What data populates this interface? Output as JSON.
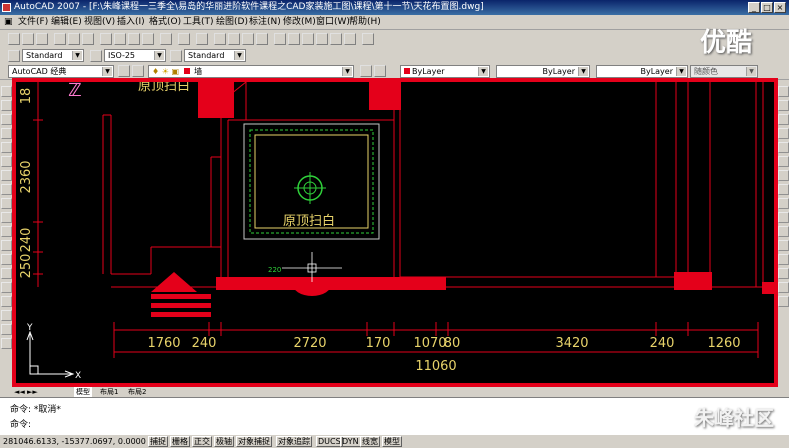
{
  "window": {
    "title": "AutoCAD 2007 - [F:\\朱峰课程一三季全\\易岛的华丽进阶软件课程之CAD家装施工图\\课程\\第十一节\\天花布置图.dwg]"
  },
  "menu": [
    "文件(F)",
    "编辑(E)",
    "视图(V)",
    "插入(I)",
    "格式(O)",
    "工具(T)",
    "绘图(D)",
    "标注(N)",
    "修改(M)",
    "窗口(W)",
    "帮助(H)"
  ],
  "styles": {
    "text_style": "Standard",
    "dim_style": "ISO-25",
    "table_style": "Standard"
  },
  "workspace": "AutoCAD 经典",
  "layer": {
    "current": "墙",
    "color": "ByLayer",
    "linetype": "ByLayer",
    "lineweight": "ByLayer",
    "plotstyle": "随颜色"
  },
  "drawing": {
    "label_top": "原顶扫白",
    "label_center": "原顶扫白",
    "elev_tag": "220",
    "vertical_dims": [
      "18",
      "2360",
      "240",
      "250"
    ],
    "horizontal_dims": [
      "1760",
      "240",
      "2720",
      "170",
      "1070",
      "80",
      "3420",
      "240",
      "1260"
    ],
    "total_dim": "11060",
    "ucs": {
      "x": "X",
      "y": "Y"
    },
    "tabs": [
      "模型",
      "布局1",
      "布局2"
    ]
  },
  "command": {
    "line1": "命令:  *取消*",
    "line2": "命令:"
  },
  "status": {
    "coords": "281046.6133, -15377.0697, 0.0000",
    "toggles": [
      "捕捉",
      "栅格",
      "正交",
      "极轴",
      "对象捕捉",
      "对象追踪",
      "DUCS",
      "DYN",
      "线宽",
      "模型"
    ]
  },
  "watermarks": {
    "top_right": "优酷",
    "bottom_right": "朱峰社区"
  },
  "colors": {
    "frame": "#e4001a",
    "wall_red": "#e4001a",
    "dim_yellow": "#e8d36a",
    "green": "#2fd03a",
    "titlebar": "#0a246a"
  }
}
